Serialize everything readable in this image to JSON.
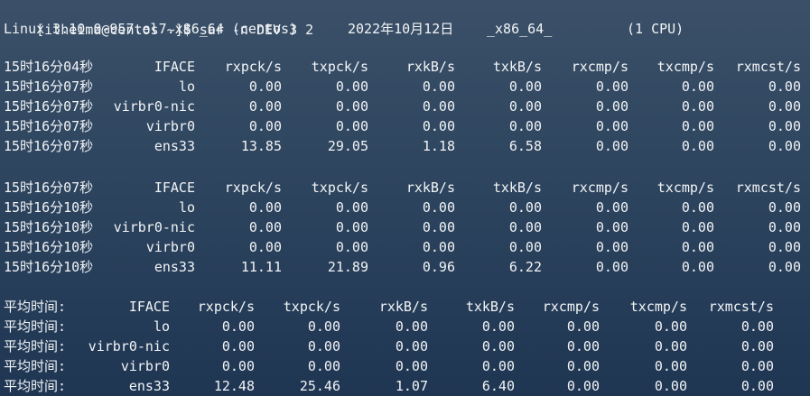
{
  "terminal": {
    "prompt_line": "[itheima@centos ~]$ sar -n DEV 3 2",
    "sysinfo": {
      "kernel": "Linux 3.10.0-957.el7.x86_64 (centos)",
      "date": "2022年10月12日",
      "arch": "_x86_64_",
      "cpu": "(1 CPU)"
    },
    "blocks": [
      {
        "header": [
          "15时16分04秒",
          "IFACE",
          "rxpck/s",
          "txpck/s",
          "rxkB/s",
          "txkB/s",
          "rxcmp/s",
          "txcmp/s",
          "rxmcst/s"
        ],
        "rows": [
          [
            "15时16分07秒",
            "lo",
            "0.00",
            "0.00",
            "0.00",
            "0.00",
            "0.00",
            "0.00",
            "0.00"
          ],
          [
            "15时16分07秒",
            "virbr0-nic",
            "0.00",
            "0.00",
            "0.00",
            "0.00",
            "0.00",
            "0.00",
            "0.00"
          ],
          [
            "15时16分07秒",
            "virbr0",
            "0.00",
            "0.00",
            "0.00",
            "0.00",
            "0.00",
            "0.00",
            "0.00"
          ],
          [
            "15时16分07秒",
            "ens33",
            "13.85",
            "29.05",
            "1.18",
            "6.58",
            "0.00",
            "0.00",
            "0.00"
          ]
        ]
      },
      {
        "header": [
          "15时16分07秒",
          "IFACE",
          "rxpck/s",
          "txpck/s",
          "rxkB/s",
          "txkB/s",
          "rxcmp/s",
          "txcmp/s",
          "rxmcst/s"
        ],
        "rows": [
          [
            "15时16分10秒",
            "lo",
            "0.00",
            "0.00",
            "0.00",
            "0.00",
            "0.00",
            "0.00",
            "0.00"
          ],
          [
            "15时16分10秒",
            "virbr0-nic",
            "0.00",
            "0.00",
            "0.00",
            "0.00",
            "0.00",
            "0.00",
            "0.00"
          ],
          [
            "15时16分10秒",
            "virbr0",
            "0.00",
            "0.00",
            "0.00",
            "0.00",
            "0.00",
            "0.00",
            "0.00"
          ],
          [
            "15时16分10秒",
            "ens33",
            "11.11",
            "21.89",
            "0.96",
            "6.22",
            "0.00",
            "0.00",
            "0.00"
          ]
        ]
      },
      {
        "header": [
          "平均时间:",
          "IFACE",
          "rxpck/s",
          "txpck/s",
          "rxkB/s",
          "txkB/s",
          "rxcmp/s",
          "txcmp/s",
          "rxmcst/s"
        ],
        "rows": [
          [
            "平均时间:",
            "lo",
            "0.00",
            "0.00",
            "0.00",
            "0.00",
            "0.00",
            "0.00",
            "0.00"
          ],
          [
            "平均时间:",
            "virbr0-nic",
            "0.00",
            "0.00",
            "0.00",
            "0.00",
            "0.00",
            "0.00",
            "0.00"
          ],
          [
            "平均时间:",
            "virbr0",
            "0.00",
            "0.00",
            "0.00",
            "0.00",
            "0.00",
            "0.00",
            "0.00"
          ],
          [
            "平均时间:",
            "ens33",
            "12.48",
            "25.46",
            "1.07",
            "6.40",
            "0.00",
            "0.00",
            "0.00"
          ]
        ]
      }
    ]
  }
}
